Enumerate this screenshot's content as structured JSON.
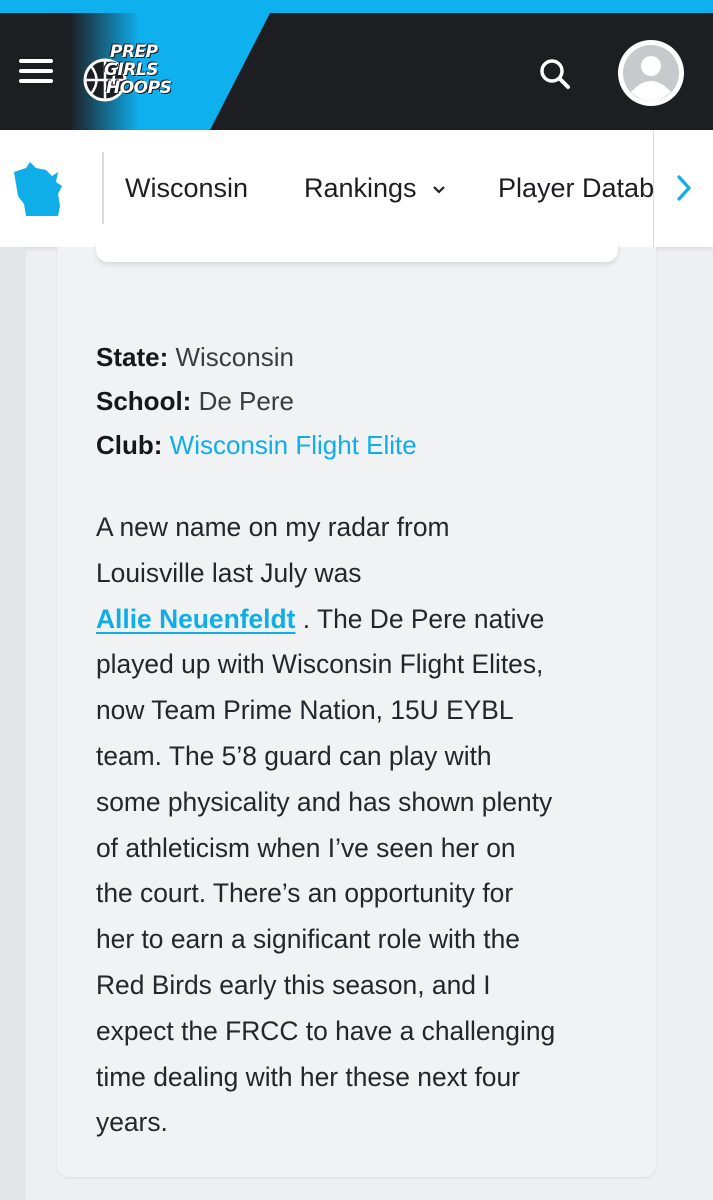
{
  "header": {
    "logo_lines": [
      "PREP",
      "GIRLS",
      "HOOPS"
    ],
    "icons": {
      "menu": "hamburger-menu-icon",
      "search": "search-icon",
      "avatar": "user-avatar-icon"
    }
  },
  "subnav": {
    "state_icon": "wisconsin-state-icon",
    "items": [
      {
        "label": "Wisconsin"
      },
      {
        "label": "Rankings",
        "has_dropdown": true
      },
      {
        "label": "Player Datab"
      }
    ],
    "next_icon": "chevron-right-icon"
  },
  "profile": {
    "state_label": "State:",
    "state_value": "Wisconsin",
    "school_label": "School:",
    "school_value": "De Pere",
    "club_label": "Club:",
    "club_value": "Wisconsin Flight Elite"
  },
  "article": {
    "lines": [
      "A new name on my radar from",
      "Louisville last July was",
      "",
      "played up with Wisconsin Flight Elites,",
      "now Team Prime Nation, 15U EYBL",
      "team. The 5’8 guard can play with",
      "some physicality and has shown plenty",
      "of athleticism when I’ve seen her on",
      "the court. There’s an opportunity for",
      "her to earn a significant role with the",
      "Red Birds early this season, and I",
      "expect the FRCC to have a challenging",
      "time dealing with her these next four",
      "years."
    ],
    "player_link": "Allie Neuenfeldt",
    "after_link": " . The De Pere native"
  },
  "colors": {
    "accent": "#0fb0ee",
    "header_bg": "#1d1e22",
    "link": "#10aee9"
  }
}
